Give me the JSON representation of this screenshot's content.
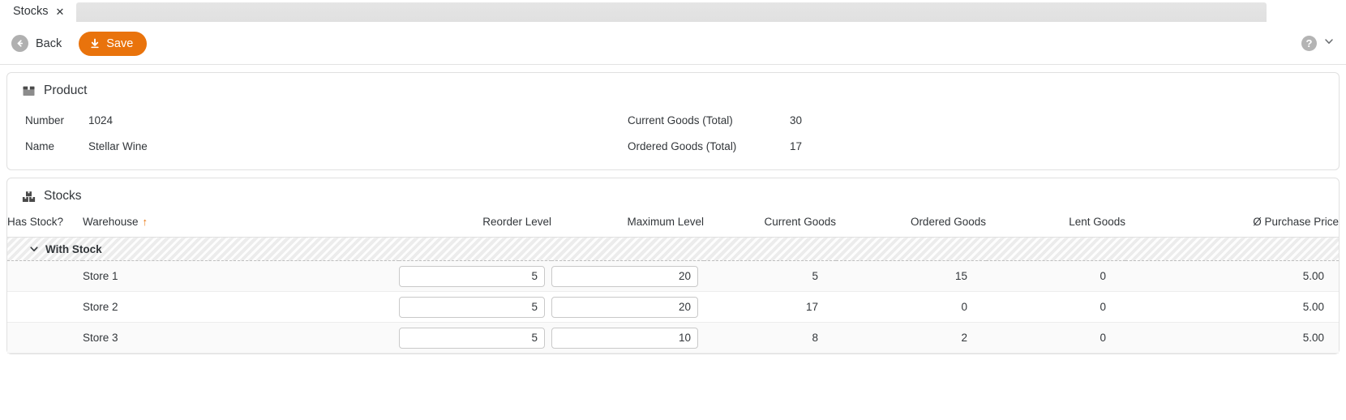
{
  "tab": {
    "label": "Stocks",
    "close_icon": "close-icon"
  },
  "toolbar": {
    "back_label": "Back",
    "save_label": "Save",
    "help_label": "?",
    "back_icon": "arrow-left-icon",
    "save_icon": "download-icon",
    "chevron_icon": "chevron-down-icon"
  },
  "product": {
    "section_title": "Product",
    "section_icon": "box-icon",
    "fields_left": [
      {
        "label": "Number",
        "value": "1024"
      },
      {
        "label": "Name",
        "value": "Stellar Wine"
      }
    ],
    "fields_right": [
      {
        "label": "Current Goods (Total)",
        "value": "30"
      },
      {
        "label": "Ordered Goods (Total)",
        "value": "17"
      }
    ]
  },
  "stocks": {
    "section_title": "Stocks",
    "section_icon": "boxes-icon",
    "columns": {
      "has_stock": "Has Stock?",
      "warehouse": "Warehouse",
      "reorder_level": "Reorder Level",
      "maximum_level": "Maximum Level",
      "current_goods": "Current Goods",
      "ordered_goods": "Ordered Goods",
      "lent_goods": "Lent Goods",
      "purchase_price": "Ø Purchase Price"
    },
    "sort_column": "Warehouse",
    "sort_direction": "ascending",
    "sort_arrow": "↑",
    "group": {
      "label": "With Stock",
      "expanded": true,
      "chevron_icon": "chevron-down-icon"
    },
    "rows": [
      {
        "has_stock": "",
        "warehouse": "Store 1",
        "reorder_level": "5",
        "maximum_level": "20",
        "current_goods": "5",
        "ordered_goods": "15",
        "lent_goods": "0",
        "purchase_price": "5.00"
      },
      {
        "has_stock": "",
        "warehouse": "Store 2",
        "reorder_level": "5",
        "maximum_level": "20",
        "current_goods": "17",
        "ordered_goods": "0",
        "lent_goods": "0",
        "purchase_price": "5.00"
      },
      {
        "has_stock": "",
        "warehouse": "Store 3",
        "reorder_level": "5",
        "maximum_level": "10",
        "current_goods": "8",
        "ordered_goods": "2",
        "lent_goods": "0",
        "purchase_price": "5.00"
      }
    ]
  },
  "colors": {
    "accent": "#e9730c",
    "text": "#32363a",
    "border": "#e0e0e0"
  }
}
